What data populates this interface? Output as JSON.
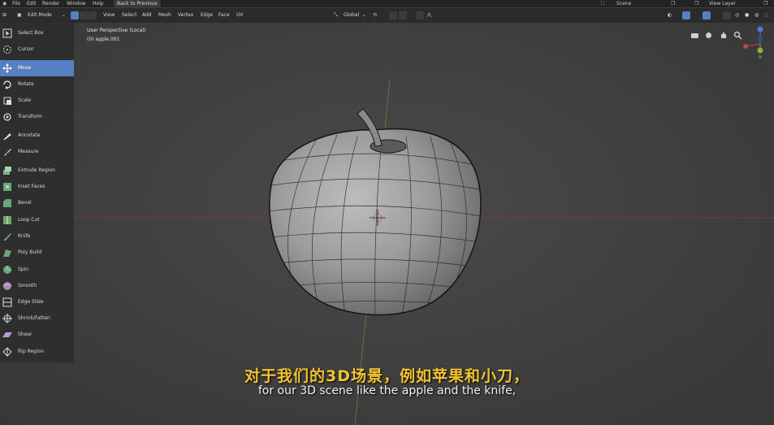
{
  "menubar": {
    "items": [
      "File",
      "Edit",
      "Render",
      "Window",
      "Help"
    ],
    "back_button": "Back to Previous",
    "scene": "Scene",
    "view_layer": "View Layer"
  },
  "header": {
    "mode": "Edit Mode",
    "menus": [
      "View",
      "Select",
      "Add",
      "Mesh",
      "Vertex",
      "Edge",
      "Face",
      "UV"
    ],
    "orientation": "Global"
  },
  "viewport": {
    "view_name": "User Perspective (Local)",
    "object": "(0) apple.001"
  },
  "toolbar": {
    "active_index": 2,
    "tools": [
      {
        "label": "Select Box",
        "icon": "select-box-icon"
      },
      {
        "label": "Cursor",
        "icon": "cursor-icon"
      },
      {
        "label": "Move",
        "icon": "move-icon"
      },
      {
        "label": "Rotate",
        "icon": "rotate-icon"
      },
      {
        "label": "Scale",
        "icon": "scale-icon"
      },
      {
        "label": "Transform",
        "icon": "transform-icon"
      },
      {
        "label": "Annotate",
        "icon": "annotate-icon"
      },
      {
        "label": "Measure",
        "icon": "measure-icon"
      },
      {
        "label": "Extrude Region",
        "icon": "extrude-region-icon"
      },
      {
        "label": "Inset Faces",
        "icon": "inset-faces-icon"
      },
      {
        "label": "Bevel",
        "icon": "bevel-icon"
      },
      {
        "label": "Loop Cut",
        "icon": "loop-cut-icon"
      },
      {
        "label": "Knife",
        "icon": "knife-icon"
      },
      {
        "label": "Poly Build",
        "icon": "poly-build-icon"
      },
      {
        "label": "Spin",
        "icon": "spin-icon"
      },
      {
        "label": "Smooth",
        "icon": "smooth-icon"
      },
      {
        "label": "Edge Slide",
        "icon": "edge-slide-icon"
      },
      {
        "label": "Shrink/Fatten",
        "icon": "shrink-fatten-icon"
      },
      {
        "label": "Shear",
        "icon": "shear-icon"
      },
      {
        "label": "Rip Region",
        "icon": "rip-region-icon"
      }
    ]
  },
  "subtitles": {
    "chinese": "对于我们的3D场景，例如苹果和小刀，",
    "english": "for our 3D scene like the apple and the knife,"
  },
  "colors": {
    "accent": "#5680c2",
    "subtitle_cn": "#f4c430",
    "axis_x": "#b23a3a",
    "axis_y": "#7a9a3a"
  }
}
